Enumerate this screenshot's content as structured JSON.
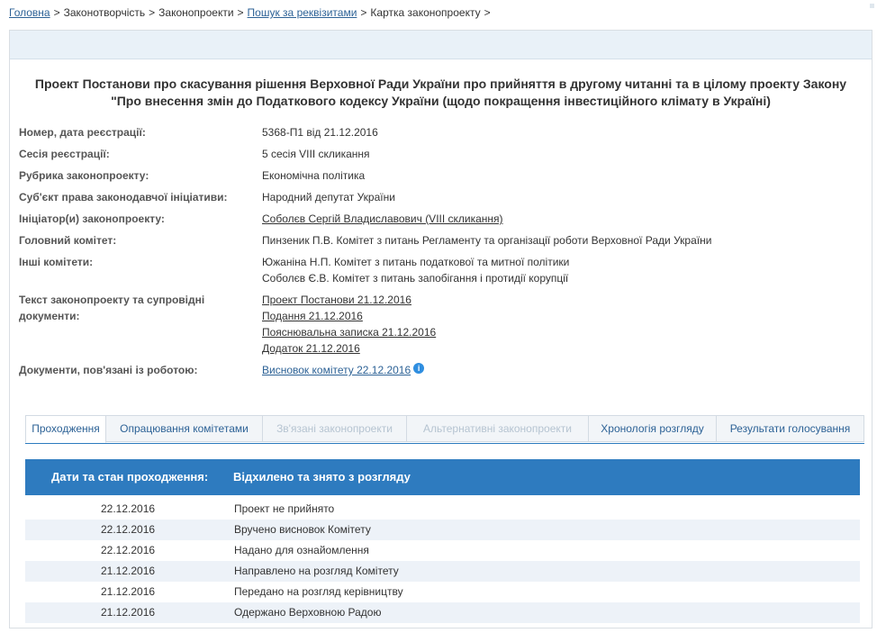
{
  "breadcrumb": {
    "home": "Головна",
    "lawmaking": "Законотворчість",
    "bills": "Законопроекти",
    "search": "Пошук за реквізитами",
    "card": "Картка законопроекту",
    "separator": ">"
  },
  "bill": {
    "title_line1": "Проект Постанови про скасування рішення Верховної Ради України про прийняття в другому читанні та в цілому проекту Закону",
    "title_line2": "\"Про внесення змін до Податкового кодексу України (щодо покращення інвестиційного клімату в Україні)"
  },
  "fields": {
    "reg_label": "Номер, дата реєстрації:",
    "reg_value": "5368-П1 від 21.12.2016",
    "session_label": "Сесія реєстрації:",
    "session_value": "5 сесія VIII скликання",
    "rubric_label": "Рубрика законопроекту:",
    "rubric_value": "Економічна політика",
    "subject_label": "Суб'єкт права законодавчої ініціативи:",
    "subject_value": "Народний депутат України",
    "initiator_label": "Ініціатор(и) законопроекту:",
    "initiator_value": "Соболєв Сергій Владиславович (VIII скликання)",
    "main_committee_label": "Головний комітет:",
    "main_committee_value": "Пинзеник П.В. Комітет з питань Регламенту та організації роботи Верховної Ради України",
    "other_committees_label": "Інші комітети:",
    "other_committees": [
      "Южаніна Н.П. Комітет з питань податкової та митної політики",
      "Соболєв Є.В. Комітет з питань запобігання і протидії корупції"
    ],
    "docs_label_line1": "Текст законопроекту та супровідні",
    "docs_label_line2": "документи:",
    "docs": [
      "Проект Постанови 21.12.2016",
      "Подання 21.12.2016",
      "Пояснювальна записка 21.12.2016",
      "Додаток 21.12.2016"
    ],
    "related_docs_label": "Документи, пов'язані із роботою:",
    "related_doc": "Висновок комітету 22.12.2016",
    "info_glyph": "i"
  },
  "tabs": [
    "Проходження",
    "Опрацювання комітетами",
    "Зв'язані законопроекти",
    "Альтернативні законопроекти",
    "Хронологія розгляду",
    "Результати голосування"
  ],
  "progress_table": {
    "header_label": "Дати та стан проходження:",
    "header_status": "Відхилено та знято з розгляду",
    "rows": [
      {
        "date": "22.12.2016",
        "status": "Проект не прийнято"
      },
      {
        "date": "22.12.2016",
        "status": "Вручено висновок Комітету"
      },
      {
        "date": "22.12.2016",
        "status": "Надано для ознайомлення"
      },
      {
        "date": "21.12.2016",
        "status": "Направлено на розгляд Комітету"
      },
      {
        "date": "21.12.2016",
        "status": "Передано на розгляд керівництву"
      },
      {
        "date": "21.12.2016",
        "status": "Одержано Верховною Радою"
      }
    ]
  },
  "colors": {
    "link": "#2d6296",
    "header_bg": "#2e7bbf",
    "alt_row": "#edf2f8",
    "top_bar": "#e9f1f8"
  }
}
